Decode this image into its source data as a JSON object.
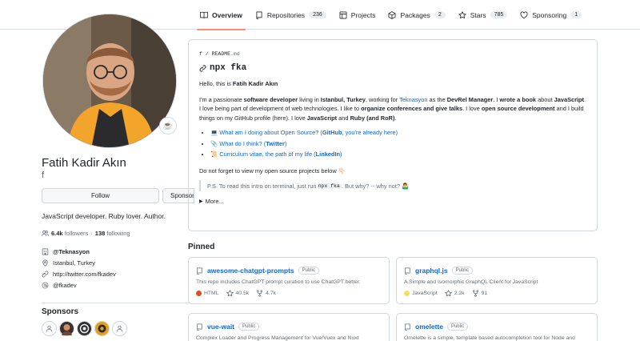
{
  "tabs": [
    {
      "label": "Overview",
      "count": null
    },
    {
      "label": "Repositories",
      "count": "236"
    },
    {
      "label": "Projects",
      "count": null
    },
    {
      "label": "Packages",
      "count": "2"
    },
    {
      "label": "Stars",
      "count": "785"
    },
    {
      "label": "Sponsoring",
      "count": "1"
    }
  ],
  "profile": {
    "status_emoji": "☕",
    "fullname": "Fatih Kadir Akın",
    "login": "f",
    "follow_label": "Follow",
    "sponsor_label": "Sponsor",
    "bio": "JavaScript developer. Ruby lover. Author.",
    "followers_count": "6.4k",
    "followers_label": "followers",
    "following_count": "138",
    "following_label": "following",
    "organization": "@Teknasyon",
    "location": "Istanbul, Turkey",
    "website": "http://twitter.com/fkadev",
    "twitter": "@fkadev",
    "sponsors_title": "Sponsors"
  },
  "readme": {
    "path_user": "f",
    "path_sep": "/",
    "path_file": "README",
    "path_ext": ".md",
    "heading": "npx fka",
    "hello_prefix": "Hello, this is ",
    "hello_name": "Fatih Kadir Akın",
    "p1": {
      "t1": "I'm a passionate ",
      "b1": "software developer",
      "t2": " living in ",
      "b2": "Istanbul, Turkey",
      "t3": ", working for ",
      "link1": "Teknasyon",
      "t4": " as the ",
      "b3": "DevRel Manager",
      "t5": ". I ",
      "b4": "wrote a book",
      "t6": " about ",
      "b5": "JavaScript",
      "t7": ". I love being part of development of web technologies. I like to ",
      "b6": "organize conferences and give talks",
      "t8": ". I love ",
      "b7": "open source development",
      "t9": " and I build things on my GitHub profile (here). I love ",
      "b8": "JavaScript",
      "t10": " and ",
      "b9": "Ruby (and RoR)",
      "t11": "."
    },
    "list": [
      {
        "emoji": "💻",
        "text": "What am I doing about Open Source? (",
        "bold": "GitHub",
        "tail": ", you're already here)"
      },
      {
        "emoji": "📎",
        "text": "What do I think? (",
        "bold": "Twitter",
        "tail": ")"
      },
      {
        "emoji": "📜",
        "text": "Curriculum vitae, the path of my life (",
        "bold": "LinkedIn",
        "tail": ")"
      }
    ],
    "open_source_text": "Do not forget to view my open source projects below",
    "open_source_emoji": "👇🏻",
    "quote_prefix": "P.S. To read this intro on terminal, just run ",
    "quote_code": "npx fka",
    "quote_suffix": ". But why? -- why not?",
    "quote_emoji": "🤷‍♂️",
    "details_label": "More..."
  },
  "pinned": {
    "title": "Pinned",
    "repos": [
      {
        "name": "awesome-chatgpt-prompts",
        "visibility": "Public",
        "description": "This repo includes ChatGPT prompt curation to use ChatGPT better.",
        "language": "HTML",
        "lang_color": "#e34c26",
        "stars": "40.5k",
        "forks": "4.7k"
      },
      {
        "name": "graphql.js",
        "visibility": "Public",
        "description": "A Simple and Isomorphic GraphQL Client for JavaScript",
        "language": "JavaScript",
        "lang_color": "#f1e05a",
        "stars": "2.2k",
        "forks": "91"
      },
      {
        "name": "vue-wait",
        "visibility": "Public",
        "description": "Complex Loader and Progress Management for Vue/Vuex and Nuxt",
        "language": "",
        "lang_color": "",
        "stars": "",
        "forks": ""
      },
      {
        "name": "omelette",
        "visibility": "Public",
        "description": "Omelette is a simple, template based autocompletion tool for Node and",
        "language": "",
        "lang_color": "",
        "stars": "",
        "forks": ""
      }
    ]
  }
}
